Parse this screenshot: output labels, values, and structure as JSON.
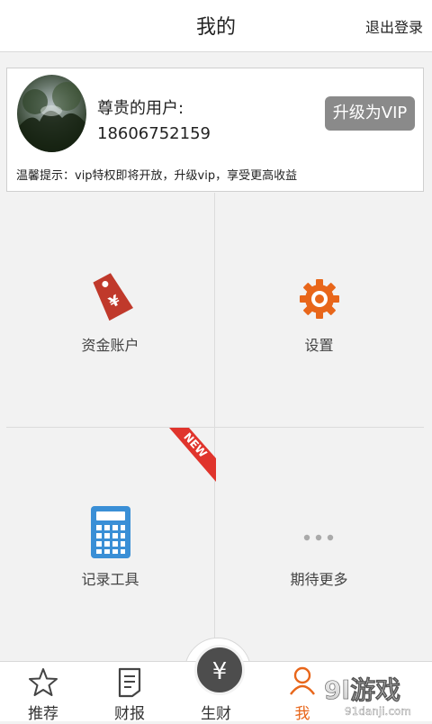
{
  "header": {
    "title": "我的",
    "logout": "退出登录"
  },
  "profile": {
    "user_label": "尊贵的用户:",
    "phone": "18606752159",
    "vip_button": "升级为VIP",
    "tip": "温馨提示：vip特权即将开放，升级vip，享受更高收益"
  },
  "grid": {
    "items": [
      {
        "label": "资金账户",
        "icon": "price-tag-yen-icon",
        "color": "#c0392b"
      },
      {
        "label": "设置",
        "icon": "gear-icon",
        "color": "#e8661a"
      },
      {
        "label": "记录工具",
        "icon": "calculator-icon",
        "color": "#3a8fd6"
      },
      {
        "label": "期待更多",
        "icon": "more-dots-icon",
        "color": "#aaaaaa"
      }
    ],
    "new_badge": "NEW",
    "new_badge_color": "#e0342c"
  },
  "tabbar": {
    "items": [
      {
        "label": "推荐",
        "icon": "star-icon"
      },
      {
        "label": "财报",
        "icon": "report-icon"
      },
      {
        "label": "生财",
        "icon": "yen-coin-icon"
      },
      {
        "label": "我",
        "icon": "user-icon",
        "active_color": "#e8661a"
      }
    ]
  },
  "watermark": {
    "text": "9l游戏",
    "subtext": "91danji.com"
  }
}
